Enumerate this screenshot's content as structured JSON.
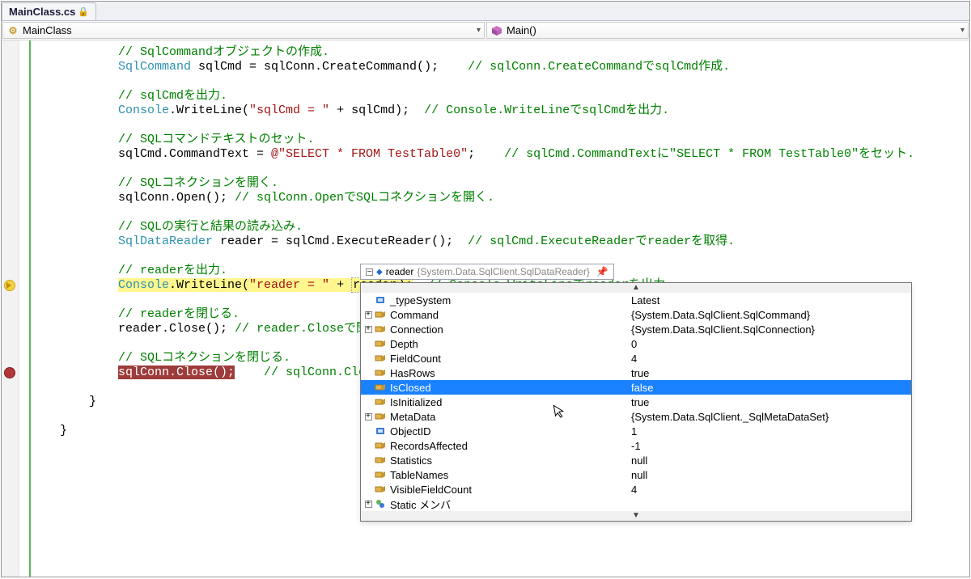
{
  "tab": {
    "title": "MainClass.cs"
  },
  "combos": {
    "left": "MainClass",
    "right": "Main()"
  },
  "icons": {
    "class": "⚙",
    "method_cube": "●"
  },
  "breakpoints": {
    "yellow_line_index": 17,
    "red_line_index": 23
  },
  "code_lines": [
    {
      "ind": 3,
      "spans": [
        {
          "c": "cm",
          "t": "// SqlCommandオブジェクトの作成."
        }
      ]
    },
    {
      "ind": 3,
      "spans": [
        {
          "c": "tp",
          "t": "SqlCommand"
        },
        {
          "t": " sqlCmd = sqlConn.CreateCommand();    "
        },
        {
          "c": "cm",
          "t": "// sqlConn.CreateCommandでsqlCmd作成."
        }
      ]
    },
    {
      "ind": 3,
      "spans": []
    },
    {
      "ind": 3,
      "spans": [
        {
          "c": "cm",
          "t": "// sqlCmdを出力."
        }
      ]
    },
    {
      "ind": 3,
      "spans": [
        {
          "c": "tp",
          "t": "Console"
        },
        {
          "t": ".WriteLine("
        },
        {
          "c": "str",
          "t": "\"sqlCmd = \""
        },
        {
          "t": " + sqlCmd);  "
        },
        {
          "c": "cm",
          "t": "// Console.WriteLineでsqlCmdを出力."
        }
      ]
    },
    {
      "ind": 3,
      "spans": []
    },
    {
      "ind": 3,
      "spans": [
        {
          "c": "cm",
          "t": "// SQLコマンドテキストのセット."
        }
      ]
    },
    {
      "ind": 3,
      "spans": [
        {
          "t": "sqlCmd.CommandText = "
        },
        {
          "c": "str",
          "t": "@\"SELECT * FROM TestTable0\""
        },
        {
          "t": ";    "
        },
        {
          "c": "cm",
          "t": "// sqlCmd.CommandTextに\"SELECT * FROM TestTable0\"をセット."
        }
      ]
    },
    {
      "ind": 3,
      "spans": []
    },
    {
      "ind": 3,
      "spans": [
        {
          "c": "cm",
          "t": "// SQLコネクションを開く."
        }
      ]
    },
    {
      "ind": 3,
      "spans": [
        {
          "t": "sqlConn.Open(); "
        },
        {
          "c": "cm",
          "t": "// sqlConn.OpenでSQLコネクションを開く."
        }
      ]
    },
    {
      "ind": 3,
      "spans": []
    },
    {
      "ind": 3,
      "spans": [
        {
          "c": "cm",
          "t": "// SQLの実行と結果の読み込み."
        }
      ]
    },
    {
      "ind": 3,
      "spans": [
        {
          "c": "tp",
          "t": "SqlDataReader"
        },
        {
          "t": " reader = sqlCmd.ExecuteReader();  "
        },
        {
          "c": "cm",
          "t": "// sqlCmd.ExecuteReaderでreaderを取得."
        }
      ]
    },
    {
      "ind": 3,
      "spans": []
    },
    {
      "ind": 3,
      "spans": [
        {
          "c": "cm",
          "t": "// readerを出力."
        }
      ]
    },
    {
      "ind": 3,
      "hl": true,
      "spans": [
        {
          "c": "tp",
          "t": "Console"
        },
        {
          "t": ".WriteLine("
        },
        {
          "c": "str",
          "t": "\"reader = \""
        },
        {
          "t": " + "
        },
        {
          "c": "boxed",
          "t": "reader"
        },
        {
          "t": ");"
        }
      ],
      "tail": [
        {
          "t": "  "
        },
        {
          "c": "cm",
          "t": "// Console.WriteLineでreaderを出力."
        }
      ]
    },
    {
      "ind": 3,
      "spans": []
    },
    {
      "ind": 3,
      "spans": [
        {
          "c": "cm",
          "t": "// readerを閉じる."
        }
      ]
    },
    {
      "ind": 3,
      "spans": [
        {
          "t": "reader.Close(); "
        },
        {
          "c": "cm",
          "t": "// reader.Closeで閉じ"
        }
      ]
    },
    {
      "ind": 3,
      "spans": []
    },
    {
      "ind": 3,
      "spans": [
        {
          "c": "cm",
          "t": "// SQLコネクションを閉じる."
        }
      ]
    },
    {
      "ind": 3,
      "bphit": true,
      "spans": [
        {
          "t": "sqlConn.Close();"
        }
      ],
      "tail": [
        {
          "t": "    "
        },
        {
          "c": "cm",
          "t": "// sqlConn.Closeで"
        }
      ]
    },
    {
      "ind": 3,
      "spans": []
    },
    {
      "ind": 2,
      "spans": [
        {
          "t": "}"
        }
      ]
    },
    {
      "ind": 0,
      "spans": []
    },
    {
      "ind": 1,
      "close": true,
      "spans": [
        {
          "t": "}"
        }
      ]
    }
  ],
  "tooltip": {
    "var": "reader",
    "type": "{System.Data.SqlClient.SqlDataReader}"
  },
  "popup": {
    "selected_index": 6,
    "rows": [
      {
        "exp": "",
        "icon": "field",
        "name": "_typeSystem",
        "value": "Latest"
      },
      {
        "exp": "+",
        "icon": "prop",
        "name": "Command",
        "value": "{System.Data.SqlClient.SqlCommand}"
      },
      {
        "exp": "+",
        "icon": "prop",
        "name": "Connection",
        "value": "{System.Data.SqlClient.SqlConnection}"
      },
      {
        "exp": "",
        "icon": "prop",
        "name": "Depth",
        "value": "0"
      },
      {
        "exp": "",
        "icon": "prop",
        "name": "FieldCount",
        "value": "4"
      },
      {
        "exp": "",
        "icon": "prop",
        "name": "HasRows",
        "value": "true"
      },
      {
        "exp": "",
        "icon": "prop",
        "name": "IsClosed",
        "value": "false"
      },
      {
        "exp": "",
        "icon": "prop",
        "name": "IsInitialized",
        "value": "true"
      },
      {
        "exp": "+",
        "icon": "prop",
        "name": "MetaData",
        "value": "{System.Data.SqlClient._SqlMetaDataSet}"
      },
      {
        "exp": "",
        "icon": "field",
        "name": "ObjectID",
        "value": "1"
      },
      {
        "exp": "",
        "icon": "prop",
        "name": "RecordsAffected",
        "value": "-1"
      },
      {
        "exp": "",
        "icon": "prop",
        "name": "Statistics",
        "value": "null"
      },
      {
        "exp": "",
        "icon": "prop",
        "name": "TableNames",
        "value": "null"
      },
      {
        "exp": "",
        "icon": "prop",
        "name": "VisibleFieldCount",
        "value": "4"
      },
      {
        "exp": "+",
        "icon": "static",
        "name": "Static メンバ",
        "value": ""
      }
    ]
  }
}
